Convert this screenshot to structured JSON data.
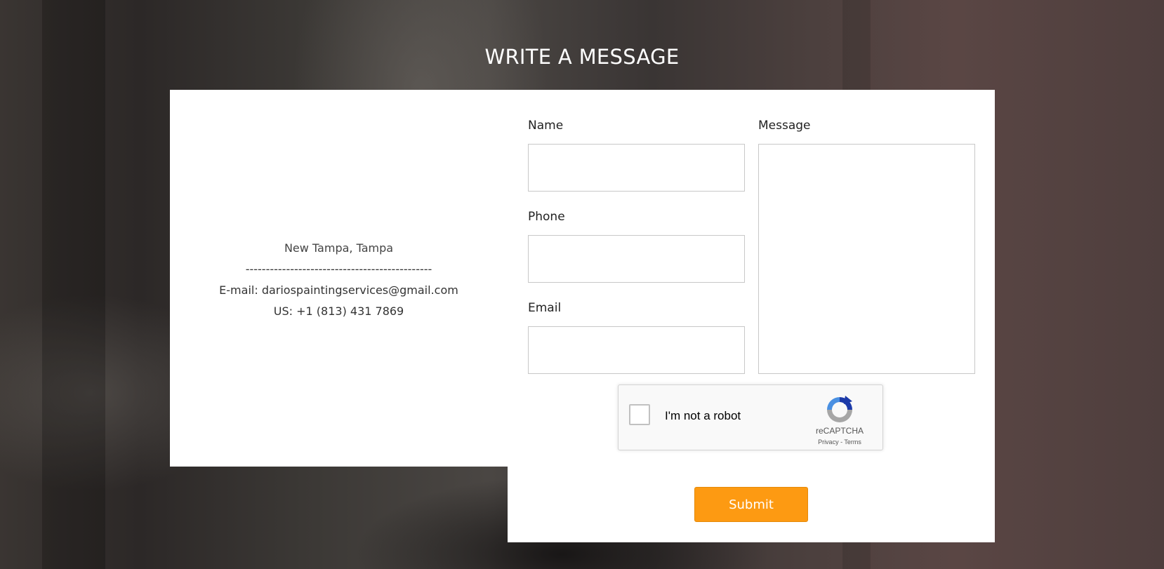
{
  "page": {
    "heading": "WRITE A MESSAGE"
  },
  "contact": {
    "city": "New Tampa, Tampa",
    "divider": "----------------------------------------------",
    "email_line": "E-mail: dariospaintingservices@gmail.com",
    "phone_line": "US: +1 (813) 431 7869"
  },
  "form": {
    "name_label": "Name",
    "name_value": "",
    "phone_label": "Phone",
    "phone_value": "",
    "email_label": "Email",
    "email_value": "",
    "message_label": "Message",
    "message_value": "",
    "submit_label": "Submit"
  },
  "recaptcha": {
    "label": "I'm not a robot",
    "brand": "reCAPTCHA",
    "privacy": "Privacy",
    "separator": " - ",
    "terms": "Terms",
    "checked": false,
    "logo_icon": "recaptcha-logo-icon"
  },
  "colors": {
    "submit_bg": "#fd9a12",
    "card_bg": "#ffffff",
    "heading_text": "#ffffff"
  }
}
